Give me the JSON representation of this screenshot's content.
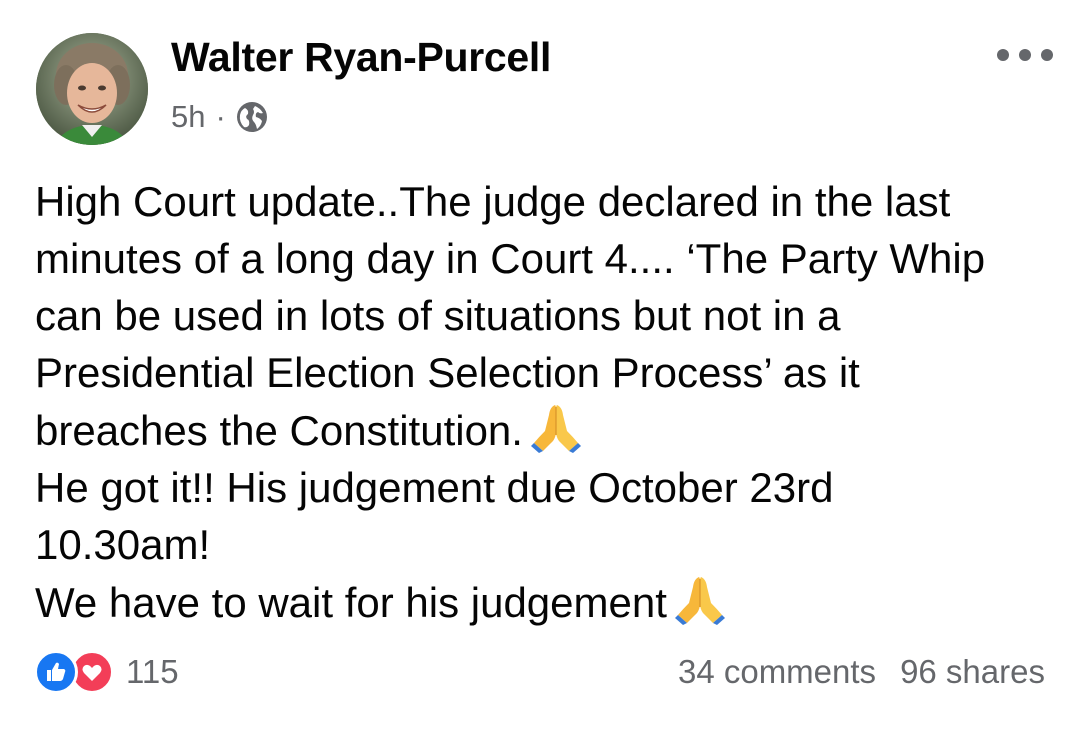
{
  "post": {
    "author": "Walter Ryan-Purcell",
    "time": "5h",
    "separator": "·",
    "audience_icon": "globe-icon",
    "more_icon": "more-dots-icon",
    "text_lines": [
      "High Court update..The judge declared in the last",
      "minutes of a long day in Court 4.... ‘The Party Whip",
      "can be used in lots of situations but not in a",
      "Presidential Election Selection Process’ as it",
      "breaches the Constitution.",
      "He got it!! His judgement due October 23rd",
      "10.30am!",
      "We have to wait for his judgement"
    ],
    "emoji": "folded-hands-emoji"
  },
  "engagement": {
    "reaction_icons": [
      "like-icon",
      "love-icon"
    ],
    "reaction_count": "115",
    "comments": "34 comments",
    "shares": "96 shares"
  },
  "colors": {
    "text_primary": "#050505",
    "text_secondary": "#65676b",
    "like_blue": "#1877f2",
    "love_red": "#f33e58"
  }
}
